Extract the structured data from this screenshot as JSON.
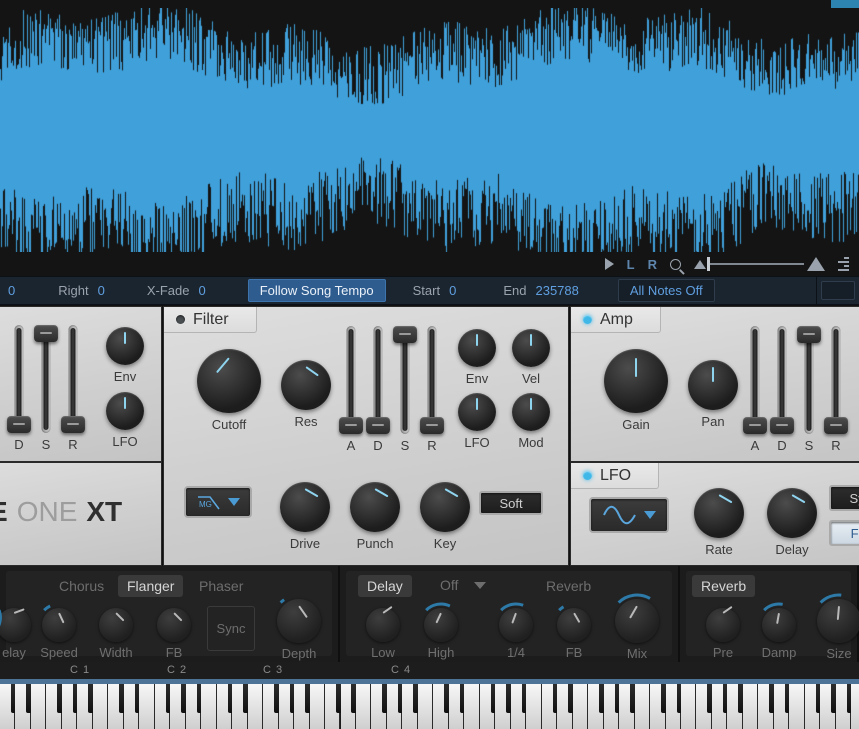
{
  "toolbar": {
    "left_value": "0",
    "fields": [
      {
        "label": "Right",
        "value": "0"
      },
      {
        "label": "X-Fade",
        "value": "0"
      }
    ],
    "follow_tempo_label": "Follow Song Tempo",
    "start": {
      "label": "Start",
      "value": "0"
    },
    "end": {
      "label": "End",
      "value": "235788"
    },
    "all_notes_off_label": "All Notes Off"
  },
  "transport": {
    "play_icon": "play-icon",
    "left_channel": "L",
    "right_channel": "R",
    "magnifier_icon": "magnifier-icon",
    "list_icon": "list-icon"
  },
  "brand": {
    "part1": "E",
    "part2": "ONE",
    "part3": "XT"
  },
  "left_panel": {
    "sliders": [
      {
        "label": "D",
        "value": 0
      },
      {
        "label": "S",
        "value": 100
      },
      {
        "label": "R",
        "value": 0
      }
    ],
    "knobs": [
      {
        "label": "Env",
        "angle": 0
      },
      {
        "label": "LFO",
        "angle": 0
      }
    ]
  },
  "filter": {
    "title": "Filter",
    "enabled": false,
    "cutoff": {
      "label": "Cutoff",
      "angle": 40,
      "ring": true
    },
    "res": {
      "label": "Res",
      "angle": -55
    },
    "sliders": [
      {
        "label": "A",
        "value": 0
      },
      {
        "label": "D",
        "value": 0
      },
      {
        "label": "S",
        "value": 100
      },
      {
        "label": "R",
        "value": 0
      }
    ],
    "mod_knobs": [
      {
        "label": "Env",
        "angle": 0
      },
      {
        "label": "Vel",
        "angle": 0
      },
      {
        "label": "LFO",
        "angle": 0
      },
      {
        "label": "Mod",
        "angle": 0
      }
    ],
    "type_selector": {
      "text": "MG",
      "icon": "lowpass-slope-icon",
      "caret": "chevron-down-icon"
    },
    "drive": {
      "label": "Drive",
      "angle": -60
    },
    "punch": {
      "label": "Punch",
      "angle": -60
    },
    "key": {
      "label": "Key",
      "angle": -60
    },
    "soft_label": "Soft"
  },
  "amp": {
    "title": "Amp",
    "enabled": true,
    "gain": {
      "label": "Gain",
      "angle": 0
    },
    "pan": {
      "label": "Pan",
      "angle": 0
    },
    "sliders": [
      {
        "label": "A",
        "value": 0
      },
      {
        "label": "D",
        "value": 0
      },
      {
        "label": "S",
        "value": 100
      },
      {
        "label": "R",
        "value": 0
      }
    ]
  },
  "lfo": {
    "title": "LFO",
    "enabled": true,
    "waveform": {
      "icon": "sine-wave-icon",
      "caret": "chevron-down-icon"
    },
    "rate": {
      "label": "Rate",
      "angle": -60
    },
    "delay": {
      "label": "Delay",
      "angle": -60
    },
    "sync_label": "Sync",
    "free_label": "Free"
  },
  "fx": {
    "modulation": {
      "tabs": [
        {
          "label": "Chorus",
          "active": false
        },
        {
          "label": "Flanger",
          "active": true
        },
        {
          "label": "Phaser",
          "active": false
        }
      ],
      "knobs": [
        {
          "label": "elay",
          "angle": -110
        },
        {
          "label": "Speed",
          "angle": -25
        },
        {
          "label": "Width",
          "angle": -45
        },
        {
          "label": "FB",
          "angle": -45
        }
      ],
      "sync_label": "Sync",
      "depth": {
        "label": "Depth",
        "angle": -35
      }
    },
    "delay": {
      "tab": "Delay",
      "mode": "Off",
      "mode_caret": "chevron-down-icon",
      "reverb_tab": "Reverb",
      "knobs": [
        {
          "label": "Low",
          "angle": -125
        },
        {
          "label": "High",
          "angle": 25
        },
        {
          "label": "1/4",
          "angle": 20
        },
        {
          "label": "FB",
          "angle": -30
        },
        {
          "label": "Mix",
          "angle": 30
        }
      ]
    },
    "reverb": {
      "tab": "Reverb",
      "knobs": [
        {
          "label": "Pre",
          "angle": -125
        },
        {
          "label": "Damp",
          "angle": 10
        },
        {
          "label": "Size",
          "angle": 5
        }
      ]
    }
  },
  "keyboard": {
    "octave_labels": [
      "C 1",
      "C 2",
      "C 3",
      "C 4"
    ],
    "octave_positions": [
      80,
      177,
      273,
      401
    ],
    "range_marker_position": 290
  },
  "colors": {
    "accent_blue": "#3fb8e8",
    "waveform_blue": "#3fa0da",
    "toolbar_bg": "#1b2530",
    "toolbar_value": "#5f9fe0",
    "panel_bg": "#d4d4d4"
  }
}
